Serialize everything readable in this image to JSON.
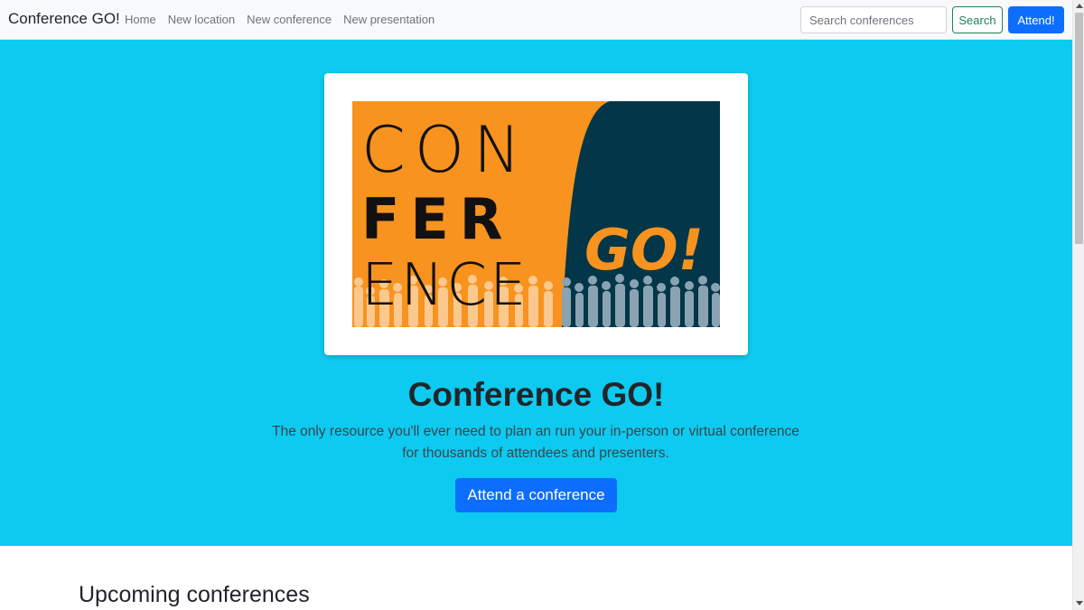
{
  "navbar": {
    "brand": "Conference GO!",
    "links": [
      "Home",
      "New location",
      "New conference",
      "New presentation"
    ],
    "search_placeholder": "Search conferences",
    "search_label": "Search",
    "attend_label": "Attend!"
  },
  "hero": {
    "logo": {
      "line1": "CON",
      "line2": "FER",
      "line3": "ENCE",
      "go_text": "GO!"
    },
    "title": "Conference GO!",
    "lead_line1": "The only resource you'll ever need to plan an run your in-person or virtual conference",
    "lead_line2": "for thousands of attendees and presenters.",
    "cta_label": "Attend a conference"
  },
  "section": {
    "heading": "Upcoming conferences"
  },
  "colors": {
    "hero_bg": "#0dcaf0",
    "primary": "#0d6efd",
    "success": "#198754",
    "logo_orange": "#f7931e",
    "logo_navy": "#033648"
  }
}
